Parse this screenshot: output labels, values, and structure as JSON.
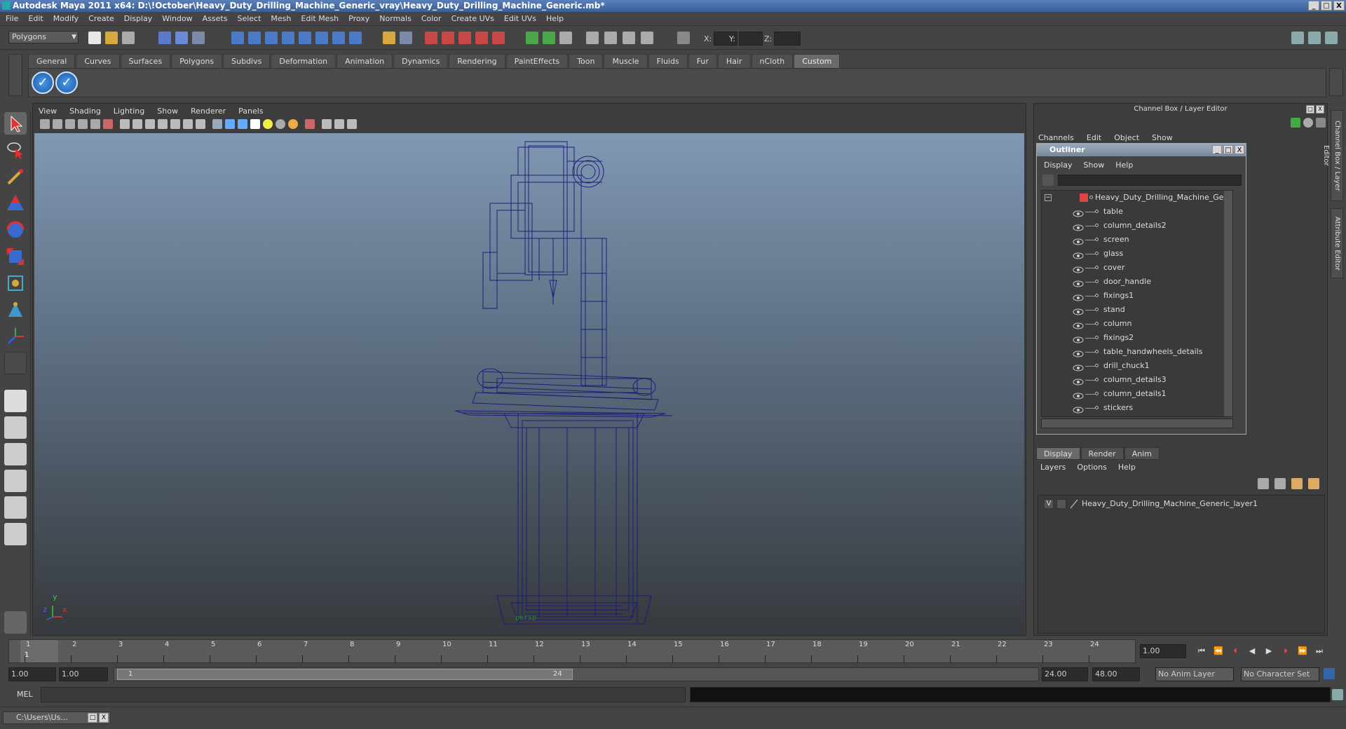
{
  "window": {
    "title": "Autodesk Maya 2011 x64: D:\\!October\\Heavy_Duty_Drilling_Machine_Generic_vray\\Heavy_Duty_Drilling_Machine_Generic.mb*",
    "minimize": "_",
    "maximize": "□",
    "close": "X"
  },
  "menubar": [
    "File",
    "Edit",
    "Modify",
    "Create",
    "Display",
    "Window",
    "Assets",
    "Select",
    "Mesh",
    "Edit Mesh",
    "Proxy",
    "Normals",
    "Color",
    "Create UVs",
    "Edit UVs",
    "Help"
  ],
  "statusline": {
    "mode": "Polygons",
    "x_label": "X:",
    "y_label": "Y:",
    "z_label": "Z:"
  },
  "shelf": {
    "tabs": [
      "General",
      "Curves",
      "Surfaces",
      "Polygons",
      "Subdivs",
      "Deformation",
      "Animation",
      "Dynamics",
      "Rendering",
      "PaintEffects",
      "Toon",
      "Muscle",
      "Fluids",
      "Fur",
      "Hair",
      "nCloth",
      "Custom"
    ],
    "active_tab": "Custom"
  },
  "viewport": {
    "menu": [
      "View",
      "Shading",
      "Lighting",
      "Show",
      "Renderer",
      "Panels"
    ],
    "axis_y": "y",
    "axis_x": "x",
    "axis_z": "z",
    "camera_label": "persp"
  },
  "channelbox": {
    "title": "Channel Box / Layer Editor",
    "menu": [
      "Channels",
      "Edit",
      "Object",
      "Show"
    ]
  },
  "side_tabs": [
    "Channel Box / Layer Editor",
    "Attribute Editor"
  ],
  "outliner": {
    "title": "Outliner",
    "menu": [
      "Display",
      "Show",
      "Help"
    ],
    "root": "Heavy_Duty_Drilling_Machine_Generic",
    "items": [
      "table",
      "column_details2",
      "screen",
      "glass",
      "cover",
      "door_handle",
      "fixings1",
      "stand",
      "column",
      "fixings2",
      "table_handwheels_details",
      "drill_chuck1",
      "column_details3",
      "column_details1",
      "stickers"
    ]
  },
  "layer_editor": {
    "tabs": [
      "Display",
      "Render",
      "Anim"
    ],
    "active_tab": "Display",
    "menu": [
      "Layers",
      "Options",
      "Help"
    ],
    "layer_visible": "V",
    "layer_name": "Heavy_Duty_Drilling_Machine_Generic_layer1"
  },
  "timeslider": {
    "ticks": [
      "1",
      "2",
      "3",
      "4",
      "5",
      "6",
      "7",
      "8",
      "9",
      "10",
      "11",
      "12",
      "13",
      "14",
      "15",
      "16",
      "17",
      "18",
      "19",
      "20",
      "21",
      "22",
      "23",
      "24"
    ],
    "current_frame_marker": "1",
    "current_time": "1.00"
  },
  "range": {
    "start": "1.00",
    "anim_start": "1.00",
    "range_start_label": "1",
    "range_end_label": "24",
    "anim_end": "24.00",
    "end": "48.00",
    "anim_layer": "No Anim Layer",
    "character_set": "No Character Set"
  },
  "cmdline": {
    "label": "MEL"
  },
  "taskbar": {
    "item": "C:\\Users\\Us..."
  },
  "colors": {
    "wireframe": "#1a1a7a",
    "viewport_top": "#8098b2",
    "viewport_bottom": "#36393d"
  }
}
